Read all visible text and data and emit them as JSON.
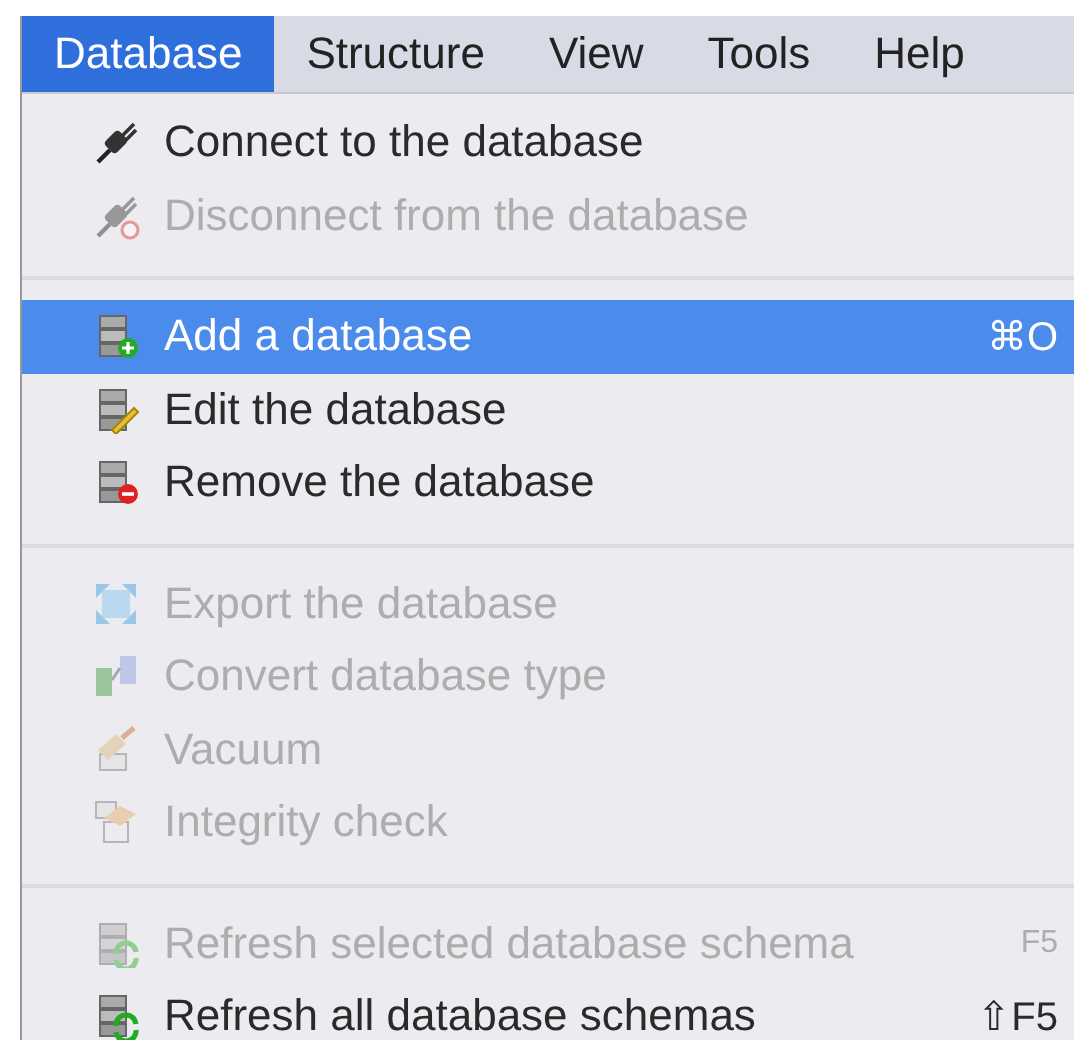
{
  "menubar": [
    {
      "label": "Database",
      "selected": true
    },
    {
      "label": "Structure",
      "selected": false
    },
    {
      "label": "View",
      "selected": false
    },
    {
      "label": "Tools",
      "selected": false
    },
    {
      "label": "Help",
      "selected": false
    }
  ],
  "menu": {
    "sections": [
      [
        {
          "label": "Connect to the database",
          "disabled": false,
          "selected": false
        },
        {
          "label": "Disconnect from the database",
          "disabled": true,
          "selected": false
        }
      ],
      [
        {
          "label": "Add a database",
          "disabled": false,
          "selected": true,
          "shortcut": "⌘O"
        },
        {
          "label": "Edit the database",
          "disabled": false,
          "selected": false
        },
        {
          "label": "Remove the database",
          "disabled": false,
          "selected": false
        }
      ],
      [
        {
          "label": "Export the database",
          "disabled": true,
          "selected": false
        },
        {
          "label": "Convert database type",
          "disabled": true,
          "selected": false
        },
        {
          "label": "Vacuum",
          "disabled": true,
          "selected": false
        },
        {
          "label": "Integrity check",
          "disabled": true,
          "selected": false
        }
      ],
      [
        {
          "label": "Refresh selected database schema",
          "disabled": true,
          "selected": false,
          "shortcut": "F5"
        },
        {
          "label": "Refresh all database schemas",
          "disabled": false,
          "selected": false,
          "shortcut": "⇧F5"
        }
      ]
    ]
  }
}
